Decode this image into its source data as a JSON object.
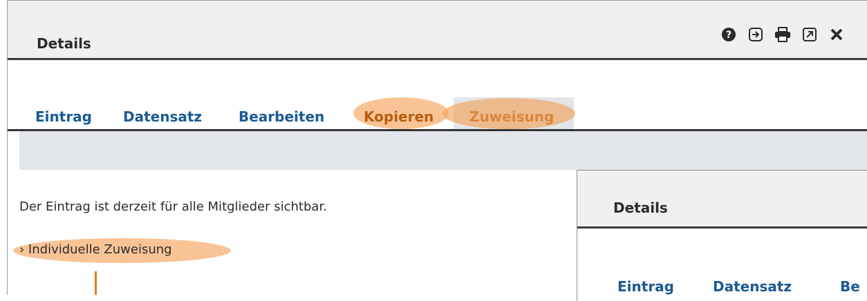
{
  "window": {
    "title": "Details",
    "toolbar": [
      {
        "name": "help-icon"
      },
      {
        "name": "exit-icon"
      },
      {
        "name": "print-icon"
      },
      {
        "name": "open-external-icon"
      },
      {
        "name": "close-icon"
      }
    ]
  },
  "tabs": [
    {
      "label": "Eintrag"
    },
    {
      "label": "Datensatz"
    },
    {
      "label": "Bearbeiten"
    },
    {
      "label": "Kopieren"
    },
    {
      "label": "Zuweisung"
    }
  ],
  "content": {
    "visibility_text": "Der Eintrag ist derzeit für alle Mitglieder sichtbar.",
    "individual_link": "› Individuelle Zuweisung"
  },
  "overlay_panel": {
    "title": "Details",
    "tabs": [
      {
        "label": "Eintrag"
      },
      {
        "label": "Datensatz"
      },
      {
        "label": "Be"
      }
    ]
  },
  "colors": {
    "link_blue": "#1b5a93",
    "active_orange": "#b45f10",
    "highlight": "#f3a056",
    "band_gray": "#e3e6ea"
  }
}
